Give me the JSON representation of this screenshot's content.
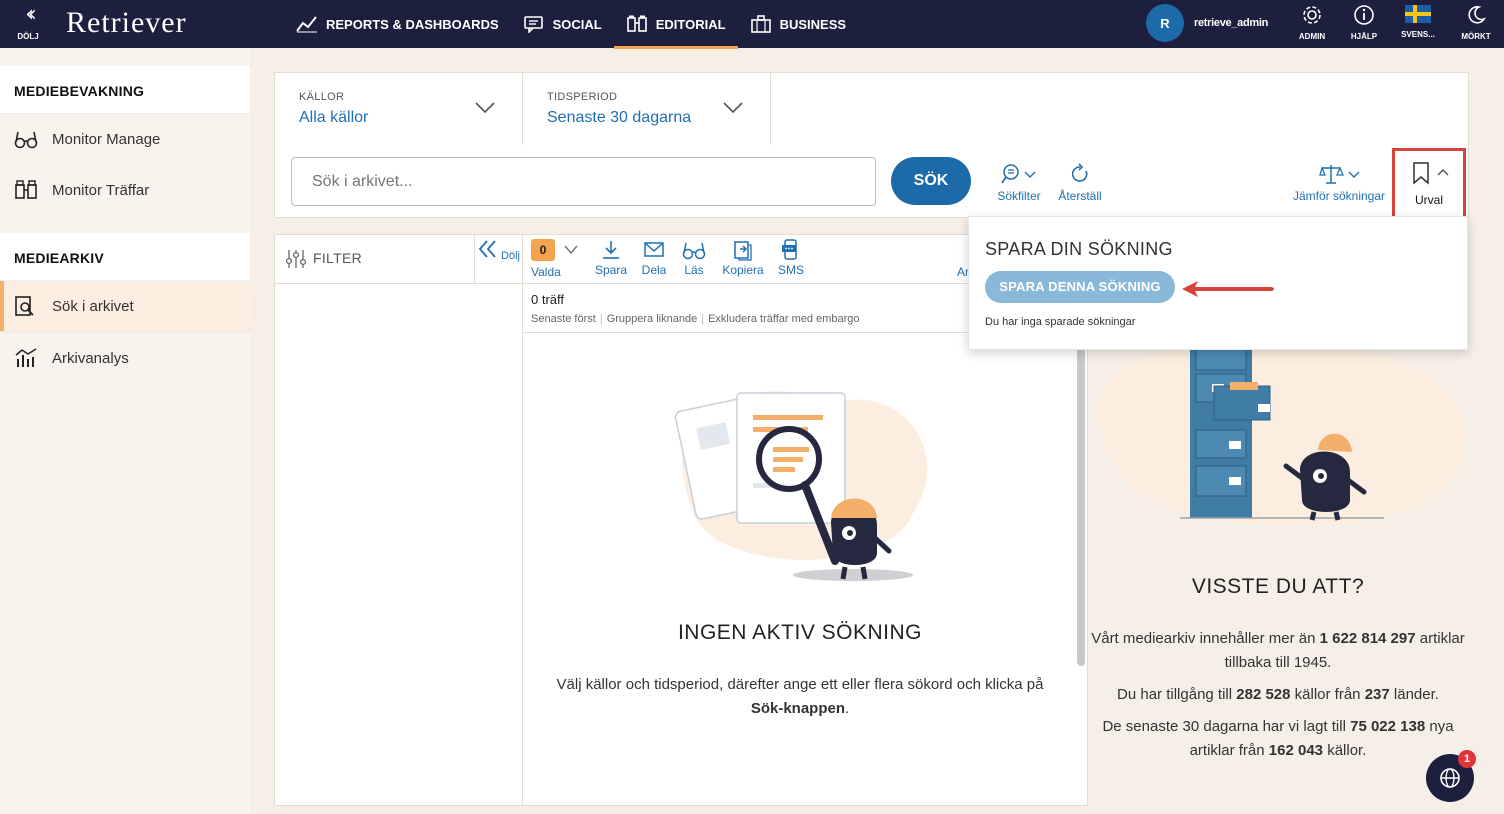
{
  "topbar": {
    "collapse_label": "DÖLJ",
    "logo": "Retriever",
    "nav": [
      {
        "label": "REPORTS & DASHBOARDS",
        "icon": "chart-line-icon"
      },
      {
        "label": "SOCIAL",
        "icon": "chat-icon"
      },
      {
        "label": "EDITORIAL",
        "icon": "binoculars-icon",
        "active": true
      },
      {
        "label": "BUSINESS",
        "icon": "briefcase-icon"
      }
    ],
    "avatar_letter": "R",
    "username": "retrieve_admin",
    "admin_label": "ADMIN",
    "help_label": "HJÄLP",
    "language_label": "SVENS...",
    "dark_label": "MÖRKT"
  },
  "sidebar": {
    "section1": "MEDIEBEVAKNING",
    "items1": [
      {
        "label": "Monitor Manage",
        "icon": "glasses-icon"
      },
      {
        "label": "Monitor Träffar",
        "icon": "binoculars-icon"
      }
    ],
    "section2": "MEDIEARKIV",
    "items2": [
      {
        "label": "Sök i arkivet",
        "icon": "search-document-icon",
        "active": true
      },
      {
        "label": "Arkivanalys",
        "icon": "bar-chart-icon"
      }
    ]
  },
  "search": {
    "sources_caption": "KÄLLOR",
    "sources_value": "Alla källor",
    "period_caption": "TIDSPERIOD",
    "period_value": "Senaste 30 dagarna",
    "placeholder": "Sök i arkivet...",
    "button": "SÖK",
    "filter_tool": "Sökfilter",
    "reset_tool": "Återställ",
    "compare_tool": "Jämför sökningar",
    "urval_tool": "Urval"
  },
  "filter": {
    "label": "FILTER",
    "hide": "Dölj"
  },
  "results": {
    "selected_count": "0",
    "toolbar": {
      "selected": "Valda",
      "save": "Spara",
      "share": "Dela",
      "read": "Läs",
      "copy": "Kopiera",
      "sms": "SMS",
      "more": "Ar"
    },
    "hits": "0 träff",
    "sort_options": [
      "Senaste först",
      "Gruppera liknande",
      "Exkludera träffar med embargo"
    ],
    "empty_title": "INGEN AKTIV SÖKNING",
    "empty_text_1": "Välj källor och tidsperiod, därefter ange ett eller flera sökord och klicka på ",
    "empty_text_bold": "Sök-knappen",
    "empty_text_2": "."
  },
  "info": {
    "title": "VISSTE DU ATT?",
    "p1_a": "Vårt mediearkiv innehåller mer än ",
    "p1_b": "1 622 814 297",
    "p1_c": " artiklar tillbaka till 1945.",
    "p2_a": "Du har tillgång till ",
    "p2_b": "282 528",
    "p2_c": " källor från ",
    "p2_d": "237",
    "p2_e": " länder.",
    "p3_a": "De senaste 30 dagarna har vi lagt till ",
    "p3_b": "75 022 138",
    "p3_c": " nya artiklar från ",
    "p3_d": "162 043",
    "p3_e": " källor."
  },
  "popup": {
    "title": "SPARA DIN SÖKNING",
    "button": "SPARA DENNA SÖKNING",
    "note": "Du har inga sparade sökningar"
  },
  "chat": {
    "badge": "1"
  },
  "colors": {
    "topbar": "#1d1f3e",
    "accent": "#f4a44c",
    "link": "#1f6fb2",
    "highlight": "#d9413b"
  }
}
